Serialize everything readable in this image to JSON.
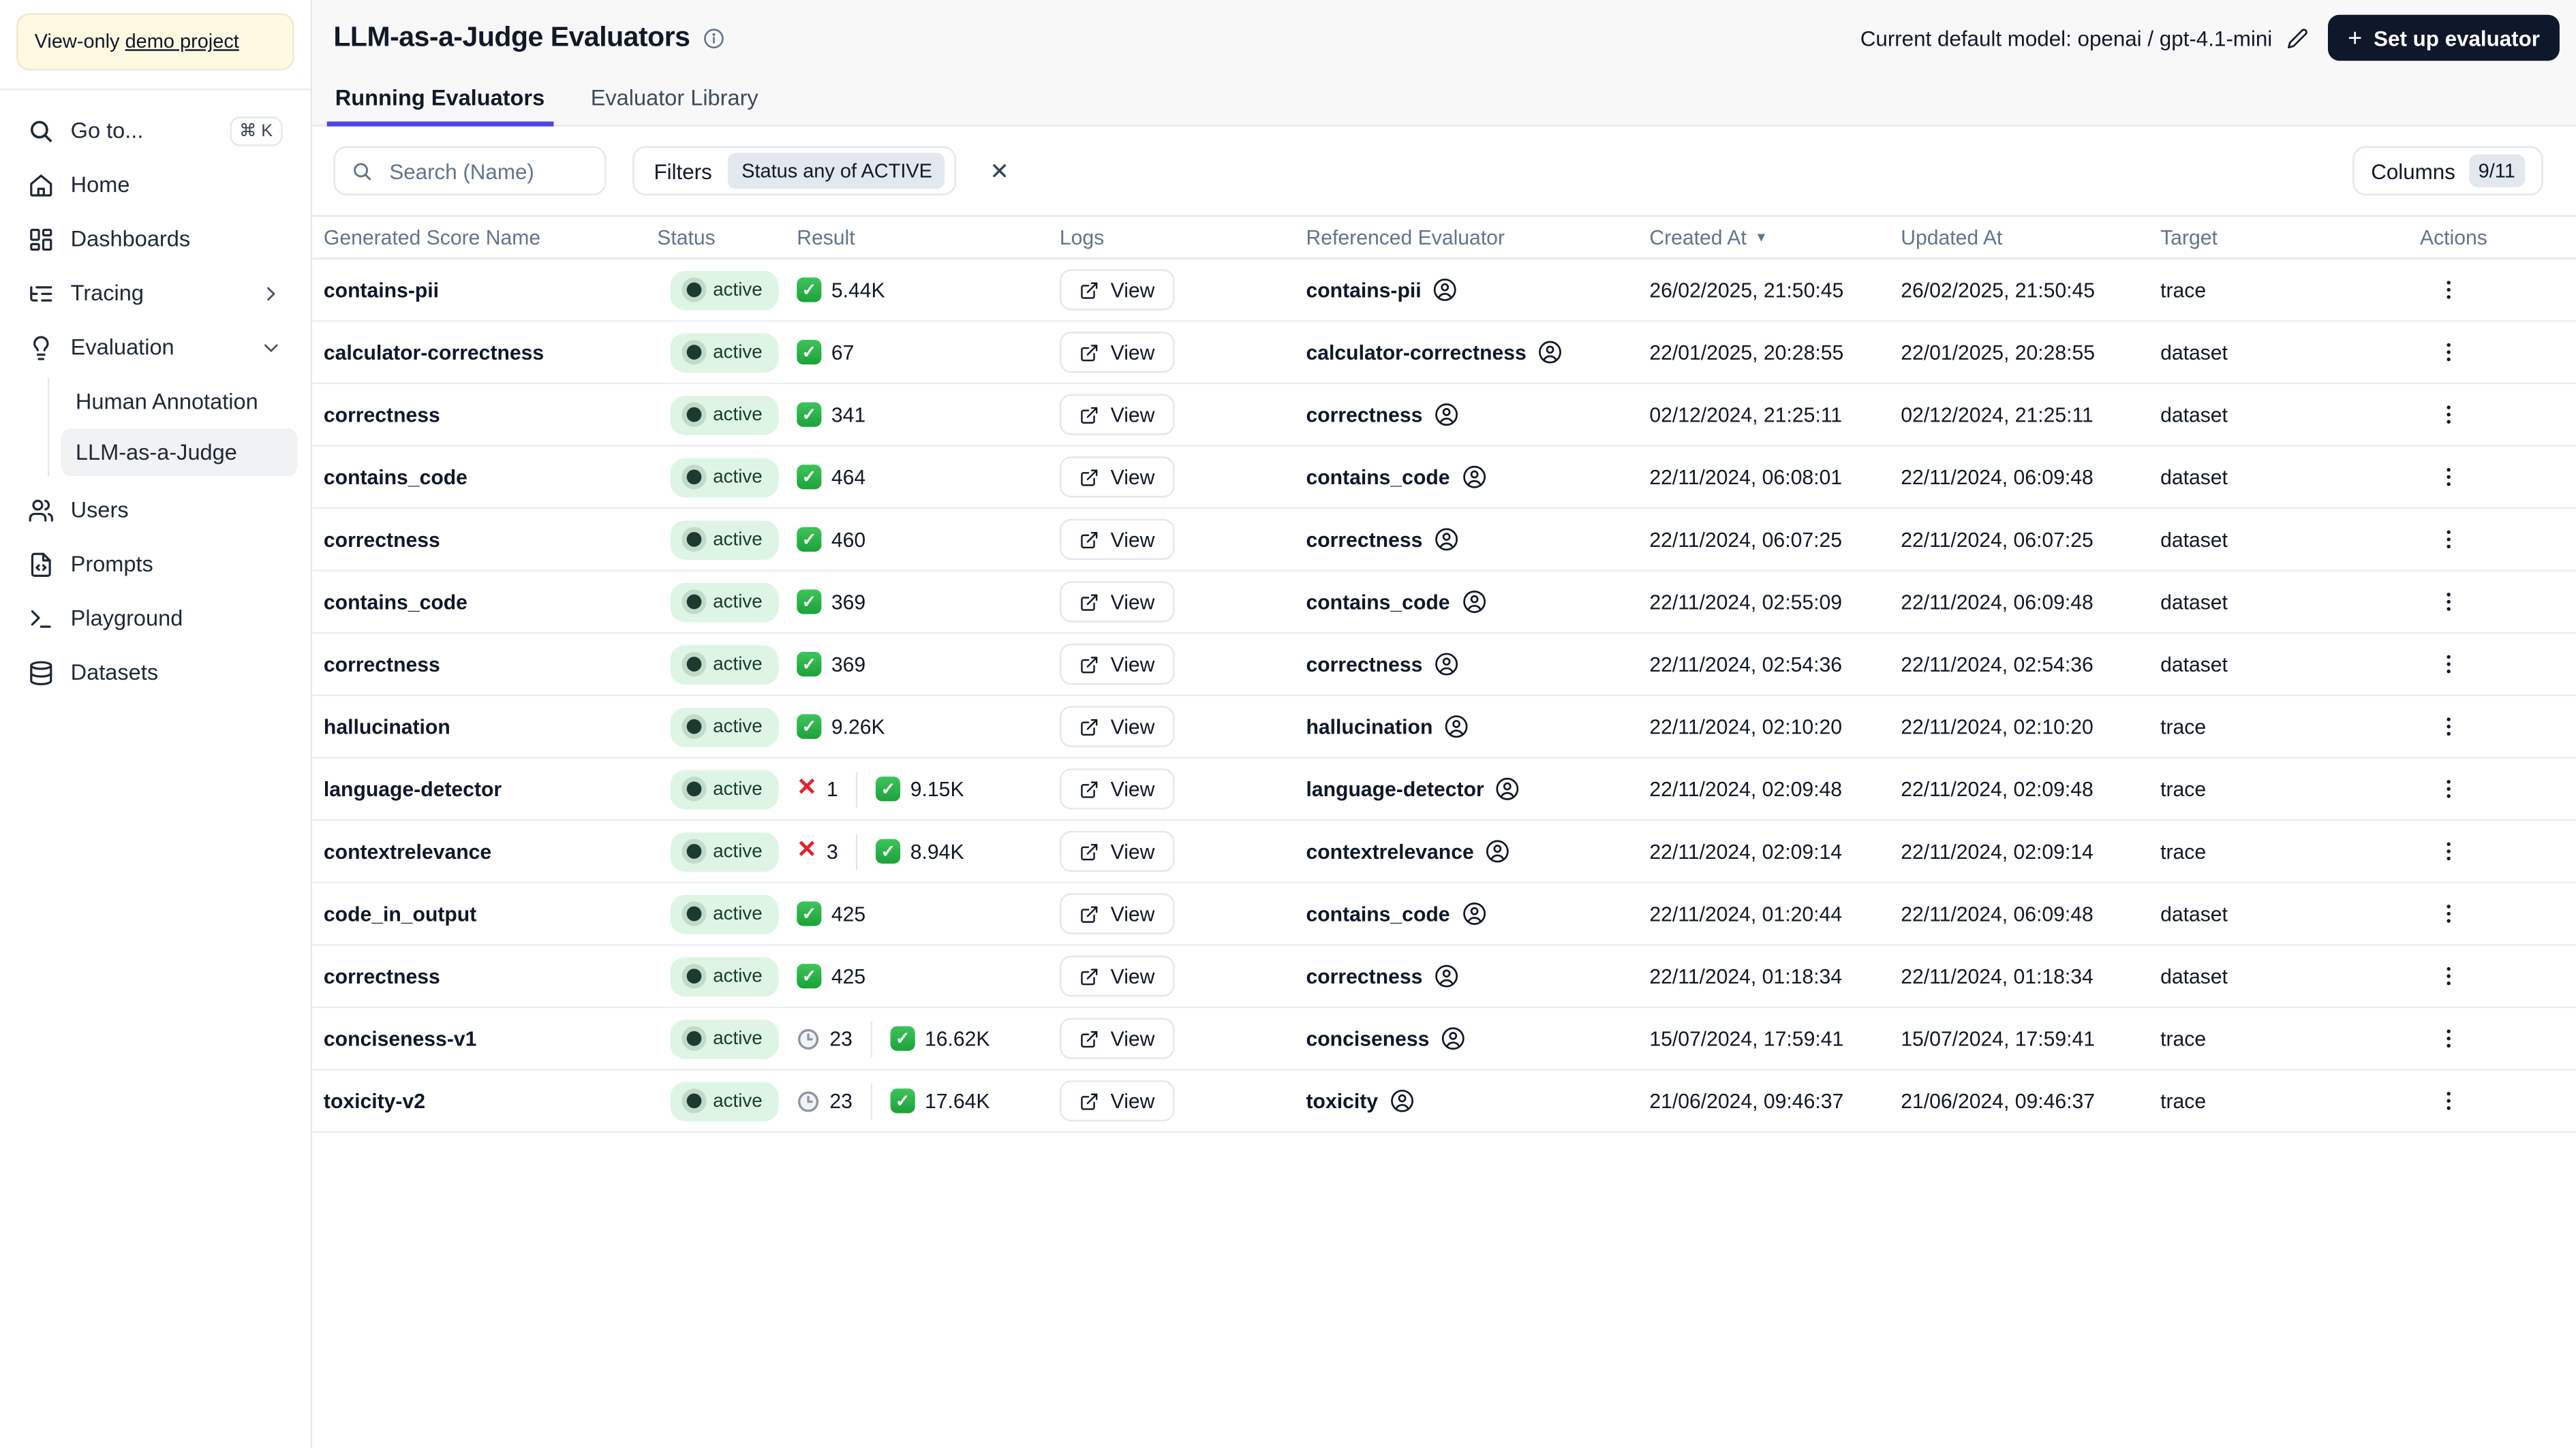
{
  "banner": {
    "prefix": "View-only",
    "link_text": "demo project"
  },
  "sidebar": {
    "go_to": {
      "label": "Go to...",
      "shortcut": "⌘ K"
    },
    "items": [
      {
        "label": "Home",
        "icon": "home-icon"
      },
      {
        "label": "Dashboards",
        "icon": "dashboards-icon"
      },
      {
        "label": "Tracing",
        "icon": "tracing-icon",
        "chevron": "right"
      },
      {
        "label": "Evaluation",
        "icon": "evaluation-icon",
        "chevron": "down"
      }
    ],
    "evaluation_children": [
      {
        "label": "Human Annotation",
        "selected": false
      },
      {
        "label": "LLM-as-a-Judge",
        "selected": true
      }
    ],
    "items_bottom": [
      {
        "label": "Users",
        "icon": "users-icon"
      },
      {
        "label": "Prompts",
        "icon": "prompts-icon"
      },
      {
        "label": "Playground",
        "icon": "playground-icon"
      },
      {
        "label": "Datasets",
        "icon": "datasets-icon"
      }
    ]
  },
  "header": {
    "title": "LLM-as-a-Judge Evaluators",
    "default_model_label": "Current default model: openai / gpt-4.1-mini",
    "setup_button_plus": "+",
    "setup_button_label": "Set up evaluator"
  },
  "tabs": [
    {
      "label": "Running Evaluators",
      "active": true
    },
    {
      "label": "Evaluator Library",
      "active": false
    }
  ],
  "filters": {
    "search_placeholder": "Search (Name)",
    "filters_label": "Filters",
    "filter_chip": "Status any of ACTIVE",
    "clear_label": "✕"
  },
  "columns_button": {
    "label": "Columns",
    "badge": "9/11"
  },
  "table": {
    "headers": [
      "Generated Score Name",
      "Status",
      "Result",
      "Logs",
      "Referenced Evaluator",
      "Created At",
      "Updated At",
      "Target",
      "Actions"
    ],
    "sort_column": "Created At",
    "sort_arrow": "▼",
    "view_label": "View",
    "check_glyph": "✓",
    "fail_glyph": "✕",
    "rows": [
      {
        "name": "contains-pii",
        "status": "active",
        "result": {
          "pass": "5.44K"
        },
        "ref": "contains-pii",
        "created": "26/02/2025, 21:50:45",
        "updated": "26/02/2025, 21:50:45",
        "target": "trace"
      },
      {
        "name": "calculator-correctness",
        "status": "active",
        "result": {
          "pass": "67"
        },
        "ref": "calculator-correctness",
        "created": "22/01/2025, 20:28:55",
        "updated": "22/01/2025, 20:28:55",
        "target": "dataset"
      },
      {
        "name": "correctness",
        "status": "active",
        "result": {
          "pass": "341"
        },
        "ref": "correctness",
        "created": "02/12/2024, 21:25:11",
        "updated": "02/12/2024, 21:25:11",
        "target": "dataset"
      },
      {
        "name": "contains_code",
        "status": "active",
        "result": {
          "pass": "464"
        },
        "ref": "contains_code",
        "created": "22/11/2024, 06:08:01",
        "updated": "22/11/2024, 06:09:48",
        "target": "dataset"
      },
      {
        "name": "correctness",
        "status": "active",
        "result": {
          "pass": "460"
        },
        "ref": "correctness",
        "created": "22/11/2024, 06:07:25",
        "updated": "22/11/2024, 06:07:25",
        "target": "dataset"
      },
      {
        "name": "contains_code",
        "status": "active",
        "result": {
          "pass": "369"
        },
        "ref": "contains_code",
        "created": "22/11/2024, 02:55:09",
        "updated": "22/11/2024, 06:09:48",
        "target": "dataset"
      },
      {
        "name": "correctness",
        "status": "active",
        "result": {
          "pass": "369"
        },
        "ref": "correctness",
        "created": "22/11/2024, 02:54:36",
        "updated": "22/11/2024, 02:54:36",
        "target": "dataset"
      },
      {
        "name": "hallucination",
        "status": "active",
        "result": {
          "pass": "9.26K"
        },
        "ref": "hallucination",
        "created": "22/11/2024, 02:10:20",
        "updated": "22/11/2024, 02:10:20",
        "target": "trace"
      },
      {
        "name": "language-detector",
        "status": "active",
        "result": {
          "fail": "1",
          "pass": "9.15K"
        },
        "ref": "language-detector",
        "created": "22/11/2024, 02:09:48",
        "updated": "22/11/2024, 02:09:48",
        "target": "trace"
      },
      {
        "name": "contextrelevance",
        "status": "active",
        "result": {
          "fail": "3",
          "pass": "8.94K"
        },
        "ref": "contextrelevance",
        "created": "22/11/2024, 02:09:14",
        "updated": "22/11/2024, 02:09:14",
        "target": "trace"
      },
      {
        "name": "code_in_output",
        "status": "active",
        "result": {
          "pass": "425"
        },
        "ref": "contains_code",
        "created": "22/11/2024, 01:20:44",
        "updated": "22/11/2024, 06:09:48",
        "target": "dataset"
      },
      {
        "name": "correctness",
        "status": "active",
        "result": {
          "pass": "425"
        },
        "ref": "correctness",
        "created": "22/11/2024, 01:18:34",
        "updated": "22/11/2024, 01:18:34",
        "target": "dataset"
      },
      {
        "name": "conciseness-v1",
        "status": "active",
        "result": {
          "pending": "23",
          "pass": "16.62K"
        },
        "ref": "conciseness",
        "created": "15/07/2024, 17:59:41",
        "updated": "15/07/2024, 17:59:41",
        "target": "trace"
      },
      {
        "name": "toxicity-v2",
        "status": "active",
        "result": {
          "pending": "23",
          "pass": "17.64K"
        },
        "ref": "toxicity",
        "created": "21/06/2024, 09:46:37",
        "updated": "21/06/2024, 09:46:37",
        "target": "trace"
      }
    ]
  },
  "colors": {
    "accent": "#4f46e5",
    "button_dark": "#0f172a",
    "status_badge_bg": "#def5e5",
    "status_badge_text": "#173b2d",
    "status_badge_dot": "#1d3a30",
    "pass_green": "#22ab41",
    "fail_red": "#e5202e",
    "banner_bg": "#fdf9e3"
  }
}
